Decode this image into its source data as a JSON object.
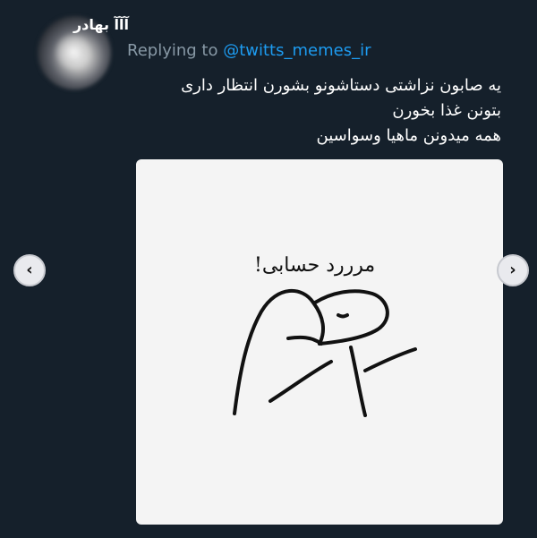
{
  "tweet": {
    "username": "آآآ بهادر",
    "replying_label": "Replying to",
    "replying_handle": "@twitts_memes_ir",
    "lines": [
      "یه صابون نزاشتی دستاشونو بشورن انتظار داری",
      "بتونن غذا بخورن",
      "همه میدونن ماهیا وسواسین"
    ]
  },
  "media": {
    "caption_word": "مرررد حسابی",
    "caption_bang": "!"
  },
  "navigation": {
    "left_icon": "chevron-left-icon",
    "right_icon": "chevron-right-icon"
  },
  "colors": {
    "background": "#15202b",
    "handle": "#1d9bf0",
    "secondary_text": "#8899a6"
  }
}
